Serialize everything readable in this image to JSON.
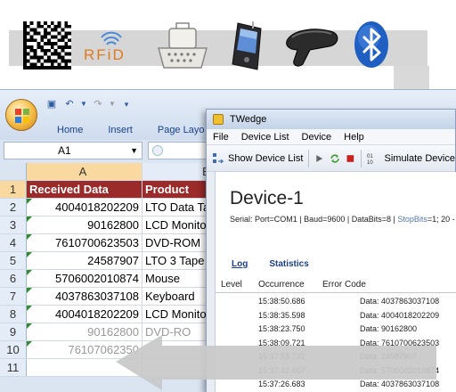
{
  "banner": {
    "icons": [
      "datamatrix-icon",
      "rfid-icon",
      "serial-connector-icon",
      "pda-icon",
      "barcode-scanner-icon",
      "bluetooth-icon"
    ],
    "rfid_text": "RFiD"
  },
  "excel": {
    "tabs": [
      "Home",
      "Insert",
      "Page Layo"
    ],
    "name_box": "A1",
    "column_headers": [
      "A",
      "B"
    ],
    "header_row": {
      "num": "1",
      "a": "Received Data",
      "b": "Product"
    },
    "rows": [
      {
        "num": "2",
        "a": "4004018202209",
        "b": "LTO Data Ta"
      },
      {
        "num": "3",
        "a": "90162800",
        "b": "LCD Monito"
      },
      {
        "num": "4",
        "a": "7610700623503",
        "b": "DVD-ROM"
      },
      {
        "num": "5",
        "a": "24587907",
        "b": "LTO 3 Tape"
      },
      {
        "num": "6",
        "a": "5706002010874",
        "b": "Mouse"
      },
      {
        "num": "7",
        "a": "4037863037108",
        "b": "Keyboard"
      },
      {
        "num": "8",
        "a": "4004018202209",
        "b": "LCD Monito"
      },
      {
        "num": "9",
        "a": "90162800",
        "b": "DVD-RO"
      },
      {
        "num": "10",
        "a": "76107062350",
        "b": ""
      },
      {
        "num": "11",
        "a": "",
        "b": ""
      }
    ],
    "colors": {
      "header_fill": "#9b2a2a",
      "ribbon": "#dbe5f2"
    }
  },
  "twedge": {
    "title": "TWedge",
    "menu": [
      "File",
      "Device List",
      "Device",
      "Help"
    ],
    "toolbar": {
      "show_device_list": "Show Device List",
      "simulate": "Simulate Device"
    },
    "device_title": "Device-1",
    "serial_info_a": "Serial: Port=COM1 | Baud=9600 | DataBits=8 | DataBits=8 | ",
    "serial_info": "Serial: Port=COM1 | Baud=9600 | DataBits=8 | ",
    "serial_info_b": "StopBits",
    "serial_info_c": "=1; 20 -",
    "links": {
      "log": "Log",
      "statistics": "Statistics"
    },
    "log_columns": [
      "Level",
      "Occurrence",
      "Error Code"
    ],
    "log_rows": [
      {
        "time": "15:38:50.686",
        "data": "Data: 4037863037108"
      },
      {
        "time": "15:38:35.598",
        "data": "Data: 4004018202209"
      },
      {
        "time": "15:38:23.750",
        "data": "Data: 90162800"
      },
      {
        "time": "15:38:09.721",
        "data": "Data: 7610700623503"
      },
      {
        "time": "15:37:53.732",
        "data": "Data: 24587907"
      },
      {
        "time": "15:37:42.467",
        "data": "Data: 5706002010874"
      },
      {
        "time": "15:37:26.683",
        "data": "Data: 4037863037108"
      }
    ]
  }
}
